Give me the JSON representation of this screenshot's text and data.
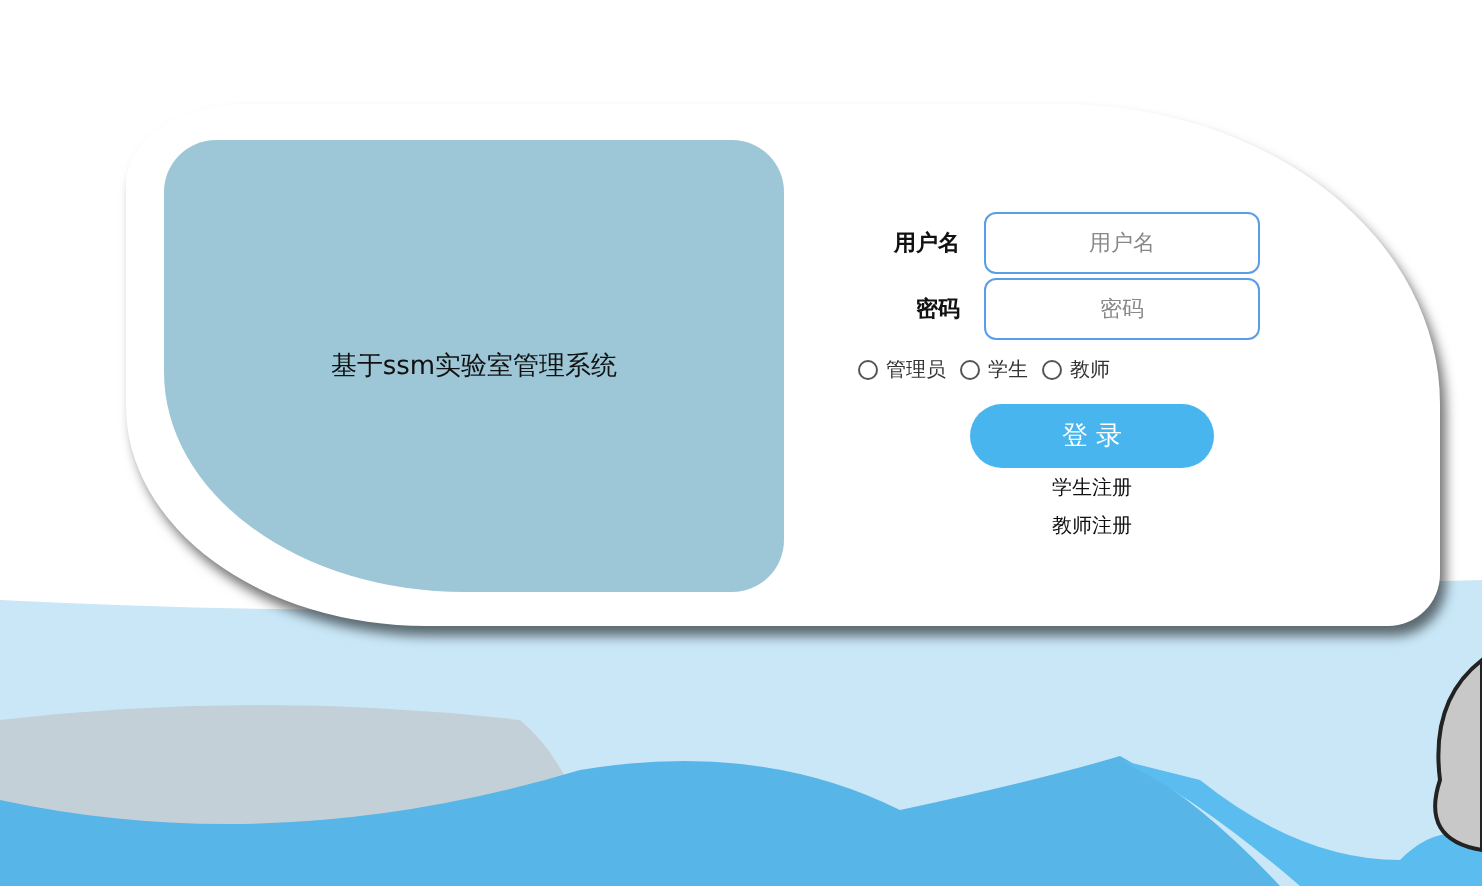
{
  "system_title": "基于ssm实验室管理系统",
  "fields": [
    {
      "label": "用户名",
      "placeholder": "用户名"
    },
    {
      "label": "密码",
      "placeholder": "密码"
    }
  ],
  "roles": [
    {
      "label": "管理员",
      "selected": false
    },
    {
      "label": "学生",
      "selected": false
    },
    {
      "label": "教师",
      "selected": false
    }
  ],
  "login_button": "登 录",
  "links": [
    "学生注册",
    "教师注册"
  ]
}
